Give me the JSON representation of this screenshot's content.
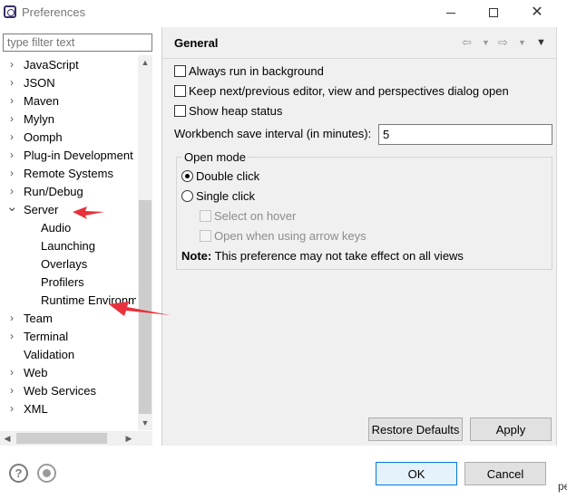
{
  "window": {
    "title": "Preferences"
  },
  "filter": {
    "placeholder": "type filter text"
  },
  "tree": {
    "items": [
      {
        "label": "JavaScript",
        "expanded": false,
        "level": 0
      },
      {
        "label": "JSON",
        "expanded": false,
        "level": 0
      },
      {
        "label": "Maven",
        "expanded": false,
        "level": 0
      },
      {
        "label": "Mylyn",
        "expanded": false,
        "level": 0
      },
      {
        "label": "Oomph",
        "expanded": false,
        "level": 0
      },
      {
        "label": "Plug-in Development",
        "expanded": false,
        "level": 0
      },
      {
        "label": "Remote Systems",
        "expanded": false,
        "level": 0
      },
      {
        "label": "Run/Debug",
        "expanded": false,
        "level": 0
      },
      {
        "label": "Server",
        "expanded": true,
        "level": 0
      },
      {
        "label": "Audio",
        "level": 1
      },
      {
        "label": "Launching",
        "level": 1
      },
      {
        "label": "Overlays",
        "level": 1
      },
      {
        "label": "Profilers",
        "level": 1
      },
      {
        "label": "Runtime Environm",
        "level": 1
      },
      {
        "label": "Team",
        "expanded": false,
        "level": 0
      },
      {
        "label": "Terminal",
        "expanded": false,
        "level": 0
      },
      {
        "label": "Validation",
        "level": 0,
        "leaf": true
      },
      {
        "label": "Web",
        "expanded": false,
        "level": 0
      },
      {
        "label": "Web Services",
        "expanded": false,
        "level": 0
      },
      {
        "label": "XML",
        "expanded": false,
        "level": 0
      }
    ]
  },
  "page": {
    "title": "General",
    "always_run_background": "Always run in background",
    "keep_next_prev": "Keep next/previous editor, view and perspectives dialog open",
    "show_heap": "Show heap status",
    "save_interval_label": "Workbench save interval (in minutes):",
    "save_interval_value": "5",
    "open_mode": {
      "title": "Open mode",
      "double_click": "Double click",
      "single_click": "Single click",
      "select_on_hover": "Select on hover",
      "open_arrow_keys": "Open when using arrow keys",
      "note_label": "Note:",
      "note_text": " This preference may not take effect on all views",
      "selected": "double_click"
    },
    "restore_defaults": "Restore Defaults",
    "apply": "Apply"
  },
  "footer": {
    "ok": "OK",
    "cancel": "Cancel",
    "edge_text": "pe"
  },
  "colors": {
    "annotation_arrow": "#e8313a",
    "default_button_border": "#0078d7"
  },
  "icons": {
    "help": "question-circle-icon",
    "record": "record-icon",
    "back": "arrow-left-icon",
    "forward": "arrow-right-icon",
    "menu": "view-menu-icon"
  }
}
